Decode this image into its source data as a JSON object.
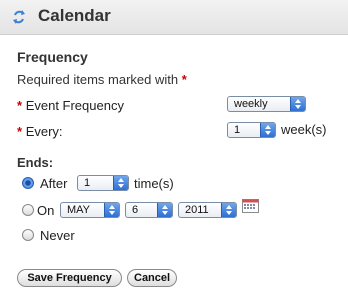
{
  "header": {
    "title": "Calendar",
    "icon": "sync-arrows-icon"
  },
  "section": {
    "title": "Frequency"
  },
  "required_note": {
    "text": "Required items marked with",
    "marker": "*"
  },
  "event_frequency": {
    "label": "Event Frequency",
    "value": "weekly"
  },
  "every": {
    "label": "Every:",
    "value": "1",
    "unit": "week(s)"
  },
  "ends": {
    "label": "Ends:",
    "after": {
      "label": "After",
      "value": "1",
      "unit": "time(s)",
      "selected": true
    },
    "on": {
      "label": "On",
      "month": "MAY",
      "day": "6",
      "year": "2011",
      "selected": false,
      "calendar_icon": "calendar-icon"
    },
    "never": {
      "label": "Never",
      "selected": false
    }
  },
  "buttons": {
    "save": "Save Frequency",
    "cancel": "Cancel"
  },
  "colors": {
    "required": "#cc0000",
    "accent": "#2e6fd3"
  }
}
